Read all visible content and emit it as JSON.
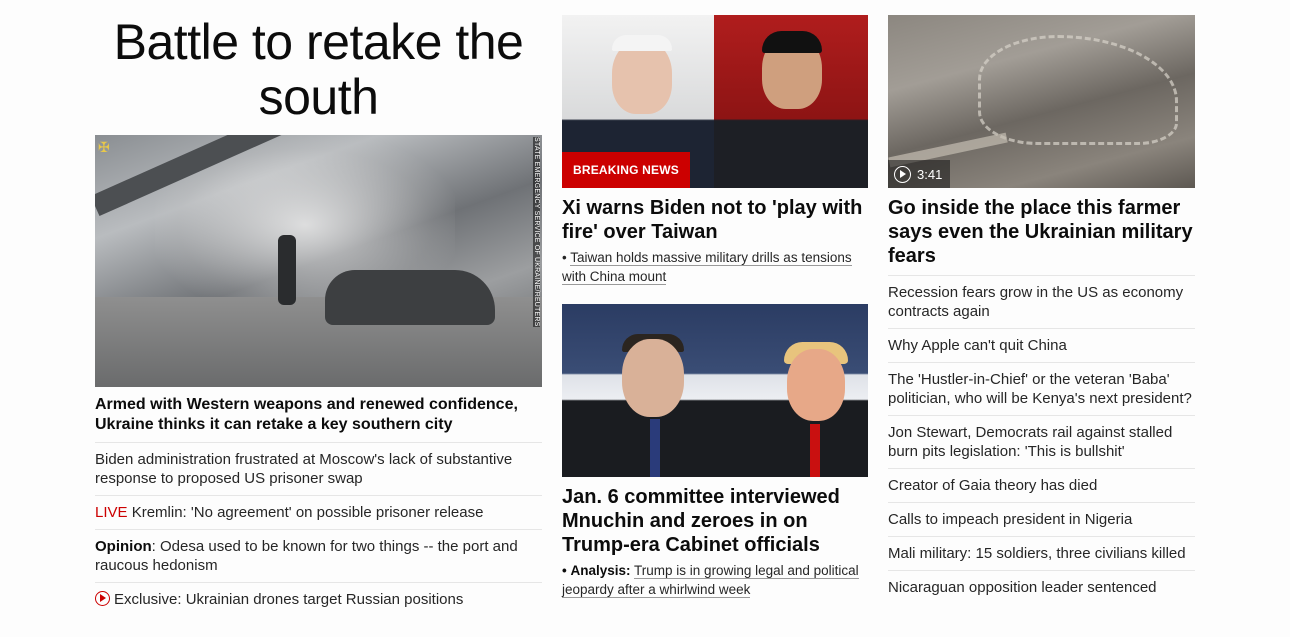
{
  "col1": {
    "zone_title": "Battle to retake the south",
    "image_credit": "STATE EMERGENCY SERVICE OF UKRAINE/REUTERS",
    "headline": "Armed with Western weapons and renewed confidence, Ukraine thinks it can retake a key southern city",
    "items": [
      {
        "text": "Biden administration frustrated at Moscow's lack of substantive response to proposed US prisoner swap"
      },
      {
        "prefix": "LIVE",
        "text": " Kremlin: 'No agreement' on possible prisoner release"
      },
      {
        "prefix": "Opinion",
        "text": ": Odesa used to be known for two things -- the port and raucous hedonism"
      },
      {
        "icon": "play-circle-icon",
        "text": "Exclusive: Ukrainian drones target Russian positions"
      }
    ]
  },
  "col2": {
    "story1": {
      "badge": "BREAKING NEWS",
      "headline": "Xi warns Biden not to 'play with fire' over Taiwan",
      "sub_bullet": "•",
      "sub": "Taiwan holds massive military drills as tensions with China mount"
    },
    "story2": {
      "headline": "Jan. 6 committee interviewed Mnuchin and zeroes in on Trump-era Cabinet officials",
      "sub_bullet": "•",
      "sub_label": "Analysis:",
      "sub": "Trump is in growing legal and political jeopardy after a whirlwind week"
    }
  },
  "col3": {
    "duration": "3:41",
    "headline": "Go inside the place this farmer says even the Ukrainian military fears",
    "items": [
      "Recession fears grow in the US as economy contracts again",
      "Why Apple can't quit China",
      "The 'Hustler-in-Chief' or the veteran 'Baba' politician, who will be Kenya's next president?",
      "Jon Stewart, Democrats rail against stalled burn pits legislation: 'This is bullshit'",
      "Creator of Gaia theory has died",
      "Calls to impeach president in Nigeria",
      "Mali military: 15 soldiers, three civilians killed",
      "Nicaraguan opposition leader sentenced"
    ]
  },
  "colors": {
    "accent_red": "#cc0000",
    "text": "#0c0c0c",
    "divider": "#e6e6e6"
  }
}
